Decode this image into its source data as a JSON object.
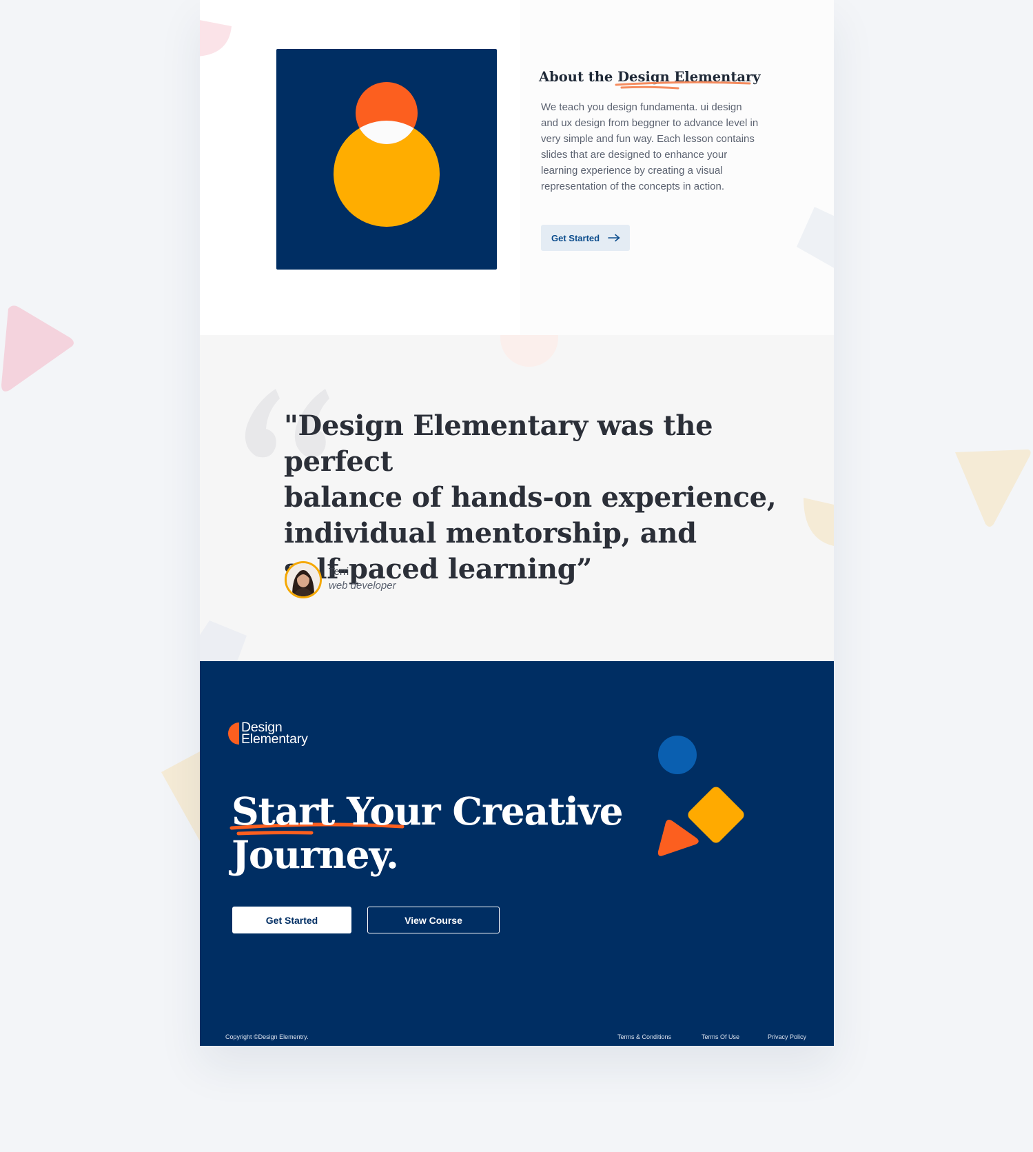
{
  "about": {
    "heading_prefix": "About the ",
    "heading_highlight": "Design Elementary",
    "body": "We teach you design fundamenta. ui design and ux design from beggner to advance level in very simple and fun way. Each lesson contains slides that are designed to enhance your learning experience by creating a visual representation of the concepts in action.",
    "button_label": "Get Started"
  },
  "testimonial": {
    "quote": "\"Design Elementary  was the perfect\nbalance of hands-on experience,\nindividual mentorship, and\nself-paced learning”",
    "author_name": "Terri",
    "author_role": "web developer"
  },
  "cta": {
    "logo_line1": "Design",
    "logo_line2": "Elementary",
    "heading_highlight": "Start Your",
    "heading_rest": " Creative Journey.",
    "primary_button": "Get Started",
    "secondary_button": "View Course"
  },
  "footer": {
    "copyright": "Copyright ©Design Elementry.",
    "links": [
      "Terms & Conditions",
      "Terms Of Use",
      "Privacy Policy"
    ]
  },
  "colors": {
    "navy": "#002e63",
    "orange": "#fc5f1f",
    "yellow": "#ffaa00",
    "blue": "#0a5fb0",
    "button_tint": "#e4ecf4"
  },
  "icons": [
    "arrow-right-icon",
    "quote-icon",
    "logo-mark-icon",
    "avatar-icon"
  ]
}
